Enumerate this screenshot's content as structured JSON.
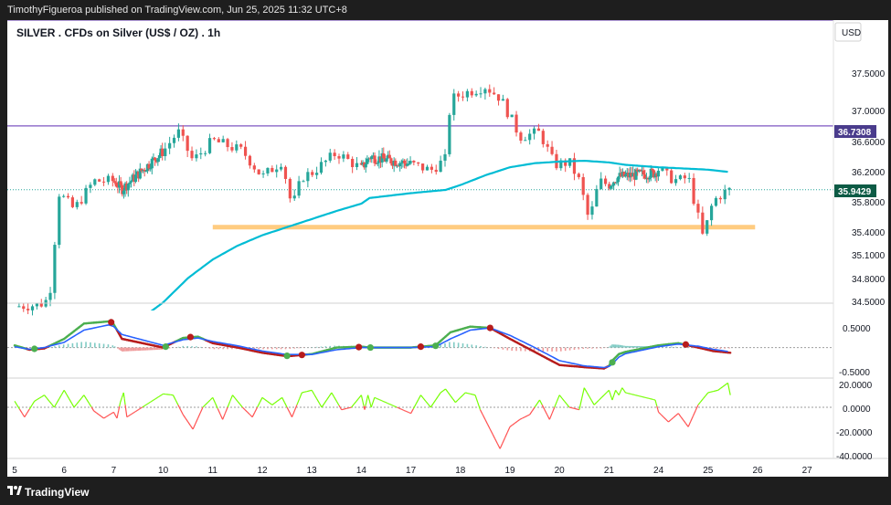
{
  "header": {
    "publisher": "TimothyFigueroa published on TradingView.com, Jun 25, 2025 11:32 UTC+8"
  },
  "chart": {
    "title": "SILVER . CFDs on Silver (US$ / OZ) . 1h",
    "currency": "USD",
    "price_ticks": [
      "37.5000",
      "37.0000",
      "36.6000",
      "36.2000",
      "35.8000",
      "35.4000",
      "35.1000",
      "34.8000",
      "34.5000"
    ],
    "level_badge": "36.7308",
    "last_badge": "35.9429",
    "osc1_ticks": [
      "0.5000",
      "-0.5000"
    ],
    "osc2_ticks": [
      "20.0000",
      "0.0000",
      "-20.0000",
      "-40.0000"
    ],
    "date_ticks": [
      "5",
      "6",
      "7",
      "10",
      "11",
      "12",
      "13",
      "14",
      "17",
      "18",
      "19",
      "20",
      "21",
      "24",
      "25",
      "26",
      "27"
    ]
  },
  "colors": {
    "up": "#26a69a",
    "down": "#ef5350",
    "ma": "#00bcd4",
    "purple_line": "#7e57c2",
    "support": "#ffcc80",
    "osc_green": "#4caf50",
    "osc_blue": "#2962ff",
    "osc_red": "#b71c1c",
    "rsi_green": "#76ff03",
    "rsi_red": "#ff5252"
  },
  "chart_data": {
    "type": "candlestick",
    "title": "SILVER . CFDs on Silver (US$ / OZ) . 1h",
    "ylabel": "USD",
    "ylim": [
      34.45,
      37.7
    ],
    "levels": {
      "horizontal": 36.7308,
      "support": 35.48,
      "last": 35.9429
    },
    "price_anchors": [
      [
        5.0,
        34.5
      ],
      [
        5.5,
        34.52
      ],
      [
        5.7,
        34.6
      ],
      [
        5.9,
        35.9
      ],
      [
        6.2,
        35.7
      ],
      [
        6.6,
        36.05
      ],
      [
        7.0,
        36.05
      ],
      [
        7.5,
        35.95
      ],
      [
        10.0,
        36.42
      ],
      [
        10.3,
        36.66
      ],
      [
        10.6,
        36.3
      ],
      [
        11.0,
        36.55
      ],
      [
        11.6,
        36.42
      ],
      [
        12.0,
        36.1
      ],
      [
        12.4,
        36.3
      ],
      [
        12.6,
        35.72
      ],
      [
        12.8,
        36.1
      ],
      [
        13.0,
        36.15
      ],
      [
        13.5,
        36.4
      ],
      [
        14.0,
        36.2
      ],
      [
        14.5,
        36.35
      ],
      [
        17.0,
        36.26
      ],
      [
        17.4,
        36.18
      ],
      [
        17.7,
        36.32
      ],
      [
        17.8,
        37.05
      ],
      [
        18.0,
        37.12
      ],
      [
        18.5,
        37.22
      ],
      [
        18.8,
        37.08
      ],
      [
        19.0,
        36.85
      ],
      [
        19.2,
        36.6
      ],
      [
        19.6,
        36.65
      ],
      [
        19.9,
        36.25
      ],
      [
        20.2,
        36.28
      ],
      [
        20.4,
        36.05
      ],
      [
        20.6,
        35.55
      ],
      [
        20.8,
        36.05
      ],
      [
        21.0,
        36.0
      ],
      [
        21.5,
        36.1
      ],
      [
        23.8,
        36.15
      ],
      [
        24.0,
        36.2
      ],
      [
        24.2,
        36.1
      ],
      [
        24.4,
        36.05
      ],
      [
        24.6,
        36.1
      ],
      [
        24.8,
        35.6
      ],
      [
        24.9,
        35.35
      ],
      [
        25.1,
        35.8
      ],
      [
        25.3,
        35.9
      ],
      [
        25.45,
        35.9429
      ]
    ],
    "ma_anchors": [
      [
        6.5,
        33.55
      ],
      [
        7.0,
        34.1
      ],
      [
        10.0,
        34.55
      ],
      [
        10.5,
        34.85
      ],
      [
        11.0,
        35.08
      ],
      [
        11.5,
        35.25
      ],
      [
        12.0,
        35.38
      ],
      [
        12.5,
        35.48
      ],
      [
        13.0,
        35.58
      ],
      [
        13.5,
        35.68
      ],
      [
        14.0,
        35.77
      ],
      [
        14.5,
        35.84
      ],
      [
        17.0,
        35.9
      ],
      [
        17.7,
        35.94
      ],
      [
        18.0,
        36.0
      ],
      [
        18.5,
        36.12
      ],
      [
        19.0,
        36.22
      ],
      [
        19.5,
        36.27
      ],
      [
        20.0,
        36.29
      ],
      [
        20.5,
        36.3
      ],
      [
        21.0,
        36.28
      ],
      [
        22.0,
        36.25
      ],
      [
        24.0,
        36.22
      ],
      [
        25.0,
        36.19
      ],
      [
        25.45,
        36.16
      ]
    ],
    "osc_range": [
      -0.7,
      0.85
    ],
    "osc_line1": [
      [
        5.0,
        0.05
      ],
      [
        5.3,
        -0.05
      ],
      [
        5.6,
        -0.02
      ],
      [
        6.0,
        0.2
      ],
      [
        6.4,
        0.55
      ],
      [
        6.9,
        0.6
      ],
      [
        7.5,
        0.2
      ],
      [
        10.0,
        0.0
      ],
      [
        10.4,
        0.22
      ],
      [
        10.7,
        0.25
      ],
      [
        11.0,
        0.1
      ],
      [
        11.5,
        0.0
      ],
      [
        12.0,
        -0.12
      ],
      [
        12.5,
        -0.2
      ],
      [
        13.0,
        -0.15
      ],
      [
        13.5,
        0.0
      ],
      [
        14.0,
        0.02
      ],
      [
        14.5,
        0.0
      ],
      [
        17.0,
        0.0
      ],
      [
        17.5,
        0.05
      ],
      [
        17.8,
        0.35
      ],
      [
        18.2,
        0.48
      ],
      [
        18.6,
        0.45
      ],
      [
        19.0,
        0.2
      ],
      [
        19.5,
        -0.1
      ],
      [
        20.0,
        -0.4
      ],
      [
        20.5,
        -0.45
      ],
      [
        20.9,
        -0.48
      ],
      [
        21.2,
        -0.3
      ],
      [
        21.6,
        -0.15
      ],
      [
        22.0,
        -0.1
      ],
      [
        24.0,
        0.05
      ],
      [
        24.4,
        0.1
      ],
      [
        24.8,
        0.0
      ],
      [
        25.1,
        -0.08
      ],
      [
        25.45,
        -0.12
      ]
    ],
    "osc_line2": [
      [
        5.0,
        0.02
      ],
      [
        5.3,
        -0.04
      ],
      [
        5.6,
        0.0
      ],
      [
        6.0,
        0.12
      ],
      [
        6.4,
        0.4
      ],
      [
        6.9,
        0.52
      ],
      [
        7.5,
        0.3
      ],
      [
        10.0,
        0.05
      ],
      [
        10.4,
        0.18
      ],
      [
        10.7,
        0.22
      ],
      [
        11.0,
        0.14
      ],
      [
        11.5,
        0.04
      ],
      [
        12.0,
        -0.08
      ],
      [
        12.5,
        -0.16
      ],
      [
        13.0,
        -0.16
      ],
      [
        13.5,
        -0.05
      ],
      [
        14.0,
        0.0
      ],
      [
        14.5,
        0.0
      ],
      [
        17.0,
        0.0
      ],
      [
        17.5,
        0.02
      ],
      [
        17.8,
        0.2
      ],
      [
        18.2,
        0.4
      ],
      [
        18.6,
        0.45
      ],
      [
        19.0,
        0.28
      ],
      [
        19.5,
        0.0
      ],
      [
        20.0,
        -0.3
      ],
      [
        20.5,
        -0.42
      ],
      [
        20.9,
        -0.46
      ],
      [
        21.2,
        -0.38
      ],
      [
        21.6,
        -0.22
      ],
      [
        22.0,
        -0.14
      ],
      [
        24.0,
        0.02
      ],
      [
        24.4,
        0.08
      ],
      [
        24.8,
        0.03
      ],
      [
        25.1,
        -0.04
      ],
      [
        25.45,
        -0.1
      ]
    ],
    "osc_markers": [
      {
        "x": 5.4,
        "v": -0.03,
        "c": "green"
      },
      {
        "x": 6.95,
        "v": 0.58,
        "c": "red"
      },
      {
        "x": 10.05,
        "v": 0.02,
        "c": "green"
      },
      {
        "x": 10.55,
        "v": 0.24,
        "c": "red"
      },
      {
        "x": 12.5,
        "v": -0.19,
        "c": "green"
      },
      {
        "x": 12.8,
        "v": -0.17,
        "c": "red"
      },
      {
        "x": 13.95,
        "v": 0.01,
        "c": "red"
      },
      {
        "x": 14.55,
        "v": 0.0,
        "c": "green"
      },
      {
        "x": 17.2,
        "v": 0.02,
        "c": "red"
      },
      {
        "x": 17.5,
        "v": 0.04,
        "c": "green"
      },
      {
        "x": 18.6,
        "v": 0.45,
        "c": "red"
      },
      {
        "x": 21.2,
        "v": -0.34,
        "c": "green"
      },
      {
        "x": 24.55,
        "v": 0.07,
        "c": "red"
      }
    ],
    "rsi_range": [
      -42,
      24
    ],
    "rsi_anchors": [
      [
        5.0,
        5
      ],
      [
        5.2,
        -8
      ],
      [
        5.4,
        5
      ],
      [
        5.6,
        10
      ],
      [
        5.8,
        0
      ],
      [
        6.0,
        14
      ],
      [
        6.2,
        0
      ],
      [
        6.4,
        10
      ],
      [
        6.6,
        -3
      ],
      [
        6.8,
        -9
      ],
      [
        7.0,
        -4
      ],
      [
        7.2,
        -9
      ],
      [
        7.4,
        4
      ],
      [
        7.6,
        12
      ],
      [
        7.8,
        -8
      ],
      [
        10.0,
        11
      ],
      [
        10.2,
        10
      ],
      [
        10.4,
        -6
      ],
      [
        10.6,
        -18
      ],
      [
        10.8,
        0
      ],
      [
        11.0,
        8
      ],
      [
        11.2,
        -10
      ],
      [
        11.4,
        10
      ],
      [
        11.6,
        0
      ],
      [
        11.8,
        -8
      ],
      [
        12.0,
        8
      ],
      [
        12.2,
        2
      ],
      [
        12.4,
        8
      ],
      [
        12.6,
        -8
      ],
      [
        12.8,
        12
      ],
      [
        13.0,
        14
      ],
      [
        13.2,
        0
      ],
      [
        13.4,
        12
      ],
      [
        13.6,
        -2
      ],
      [
        13.8,
        0
      ],
      [
        14.0,
        10
      ],
      [
        14.2,
        -2
      ],
      [
        14.4,
        10
      ],
      [
        14.6,
        0
      ],
      [
        14.8,
        8
      ],
      [
        17.0,
        -5
      ],
      [
        17.2,
        10
      ],
      [
        17.4,
        0
      ],
      [
        17.6,
        12
      ],
      [
        17.7,
        15
      ],
      [
        17.9,
        4
      ],
      [
        18.1,
        12
      ],
      [
        18.3,
        10
      ],
      [
        18.4,
        -2
      ],
      [
        18.6,
        -18
      ],
      [
        18.8,
        -34
      ],
      [
        19.0,
        -16
      ],
      [
        19.2,
        -10
      ],
      [
        19.4,
        -6
      ],
      [
        19.6,
        6
      ],
      [
        19.8,
        -10
      ],
      [
        20.0,
        10
      ],
      [
        20.2,
        0
      ],
      [
        20.4,
        -2
      ],
      [
        20.5,
        16
      ],
      [
        20.7,
        2
      ],
      [
        21.0,
        14
      ],
      [
        21.2,
        6
      ],
      [
        21.4,
        14
      ],
      [
        21.6,
        10
      ],
      [
        21.8,
        16
      ],
      [
        22.0,
        12
      ],
      [
        23.8,
        6
      ],
      [
        24.0,
        -4
      ],
      [
        24.2,
        -12
      ],
      [
        24.4,
        -5
      ],
      [
        24.6,
        -16
      ],
      [
        24.8,
        2
      ],
      [
        25.0,
        12
      ],
      [
        25.2,
        14
      ],
      [
        25.4,
        20
      ],
      [
        25.45,
        10
      ]
    ]
  }
}
